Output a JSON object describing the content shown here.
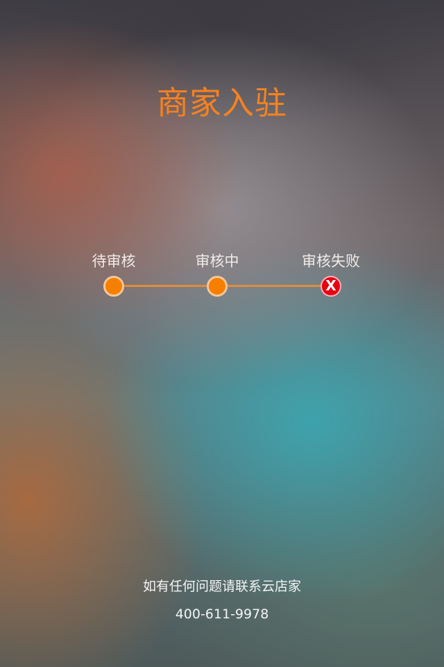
{
  "page": {
    "title": "商家入驻"
  },
  "progress": {
    "steps": [
      {
        "label": "待审核",
        "status": "done"
      },
      {
        "label": "审核中",
        "status": "done"
      },
      {
        "label": "审核失败",
        "status": "failed",
        "icon": "close-icon"
      }
    ],
    "fail_glyph": "X",
    "colors": {
      "accent": "#f77f00",
      "line": "#e08d3c",
      "failed": "#e60012"
    }
  },
  "footer": {
    "contact_text": "如有任何问题请联系云店家",
    "phone": "400-611-9978"
  }
}
